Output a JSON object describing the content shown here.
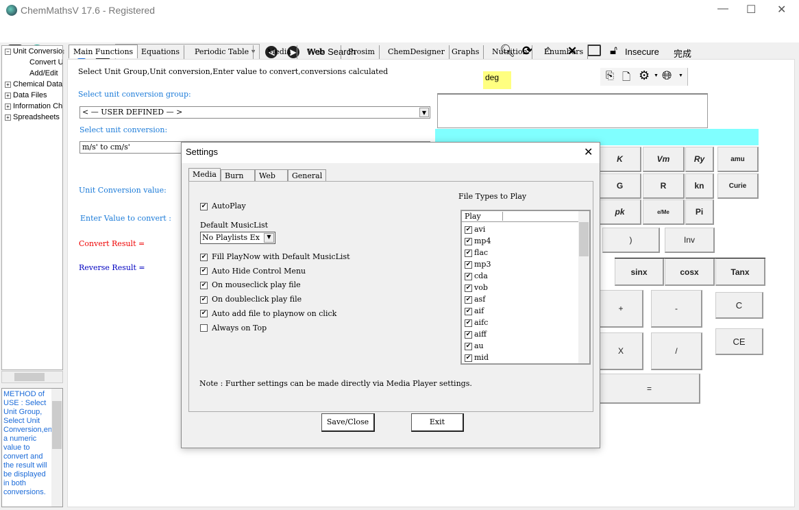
{
  "window": {
    "title": "ChemMathsV 17.6 - Registered",
    "minimize": "—",
    "maximize": "☐",
    "close": "✕"
  },
  "toolbar": {
    "web_search": "Web Search",
    "insecure": "Insecure",
    "done": "完成",
    "back": "◀",
    "forward": "▶"
  },
  "tree": {
    "items": [
      {
        "label": "Unit Conversion",
        "expander": "−"
      },
      {
        "label": "Convert Units"
      },
      {
        "label": "Add/Edit"
      },
      {
        "label": "Chemical Data",
        "expander": "+"
      },
      {
        "label": "Data Files",
        "expander": "+"
      },
      {
        "label": "Information Charts",
        "expander": "+"
      },
      {
        "label": "Spreadsheets",
        "expander": "+"
      }
    ]
  },
  "method_text": "METHOD of USE : Select Unit Group, Select Unit Conversion,enter a numeric value to convert and the result will be displayed in both conversions.",
  "tabs": [
    "Main Functions",
    "Equations",
    "Periodic Table",
    "Media",
    "Web",
    "Prosim",
    "ChemDesigner",
    "Graphs",
    "Nutrition",
    "Enumbers"
  ],
  "active_tab": "Main Functions",
  "main": {
    "instructions": "Select Unit Group,Unit conversion,Enter value to convert,conversions calculated",
    "group_label": "Select unit conversion group:",
    "group_value": "< — USER DEFINED — >",
    "conversion_label": "Select unit conversion:",
    "conversion_value": "m/s' to cm/s'",
    "value_label": "Unit Conversion value:",
    "enter_label": "Enter Value to convert :",
    "convert_result": "Convert Result =",
    "reverse_result": "Reverse Result =",
    "angle_mode": "deg"
  },
  "calculator": {
    "buttons": [
      "K",
      "Vm",
      "Ry",
      "amu",
      "G",
      "R",
      "kn",
      "Curie",
      "pk",
      "e/Me",
      "Pi",
      ")",
      "Inv",
      "sinx",
      "cosx",
      "Tanx",
      "+",
      "-",
      "C",
      "X",
      "/",
      "CE",
      "="
    ],
    "colors": {
      "display_bar": "#80ffff",
      "angle_highlight": "#ffff80"
    }
  },
  "settings": {
    "title": "Settings",
    "close": "✕",
    "tabs": [
      "Media",
      "Burn",
      "Web",
      "General"
    ],
    "active_tab": "Media",
    "autoplay": {
      "label": "AutoPlay",
      "checked": true
    },
    "musiclist_label": "Default MusicList",
    "musiclist_value": "No Playlists Ex",
    "options": [
      {
        "label": "Fill PlayNow with Default MusicList",
        "checked": true
      },
      {
        "label": "Auto Hide Control Menu",
        "checked": true
      },
      {
        "label": "On mouseclick play file",
        "checked": true
      },
      {
        "label": "On doubleclick play file",
        "checked": true
      },
      {
        "label": "Auto add file to playnow on click",
        "checked": true
      },
      {
        "label": "Always on Top",
        "checked": false
      }
    ],
    "file_types_label": "File Types to Play",
    "list_header": "Play",
    "file_types": [
      "avi",
      "mp4",
      "flac",
      "mp3",
      "cda",
      "vob",
      "asf",
      "aif",
      "aifc",
      "aiff",
      "au",
      "mid"
    ],
    "note": "Note : Further settings can be made directly via Media Player settings.",
    "save_label": "Save/Close",
    "exit_label": "Exit"
  }
}
